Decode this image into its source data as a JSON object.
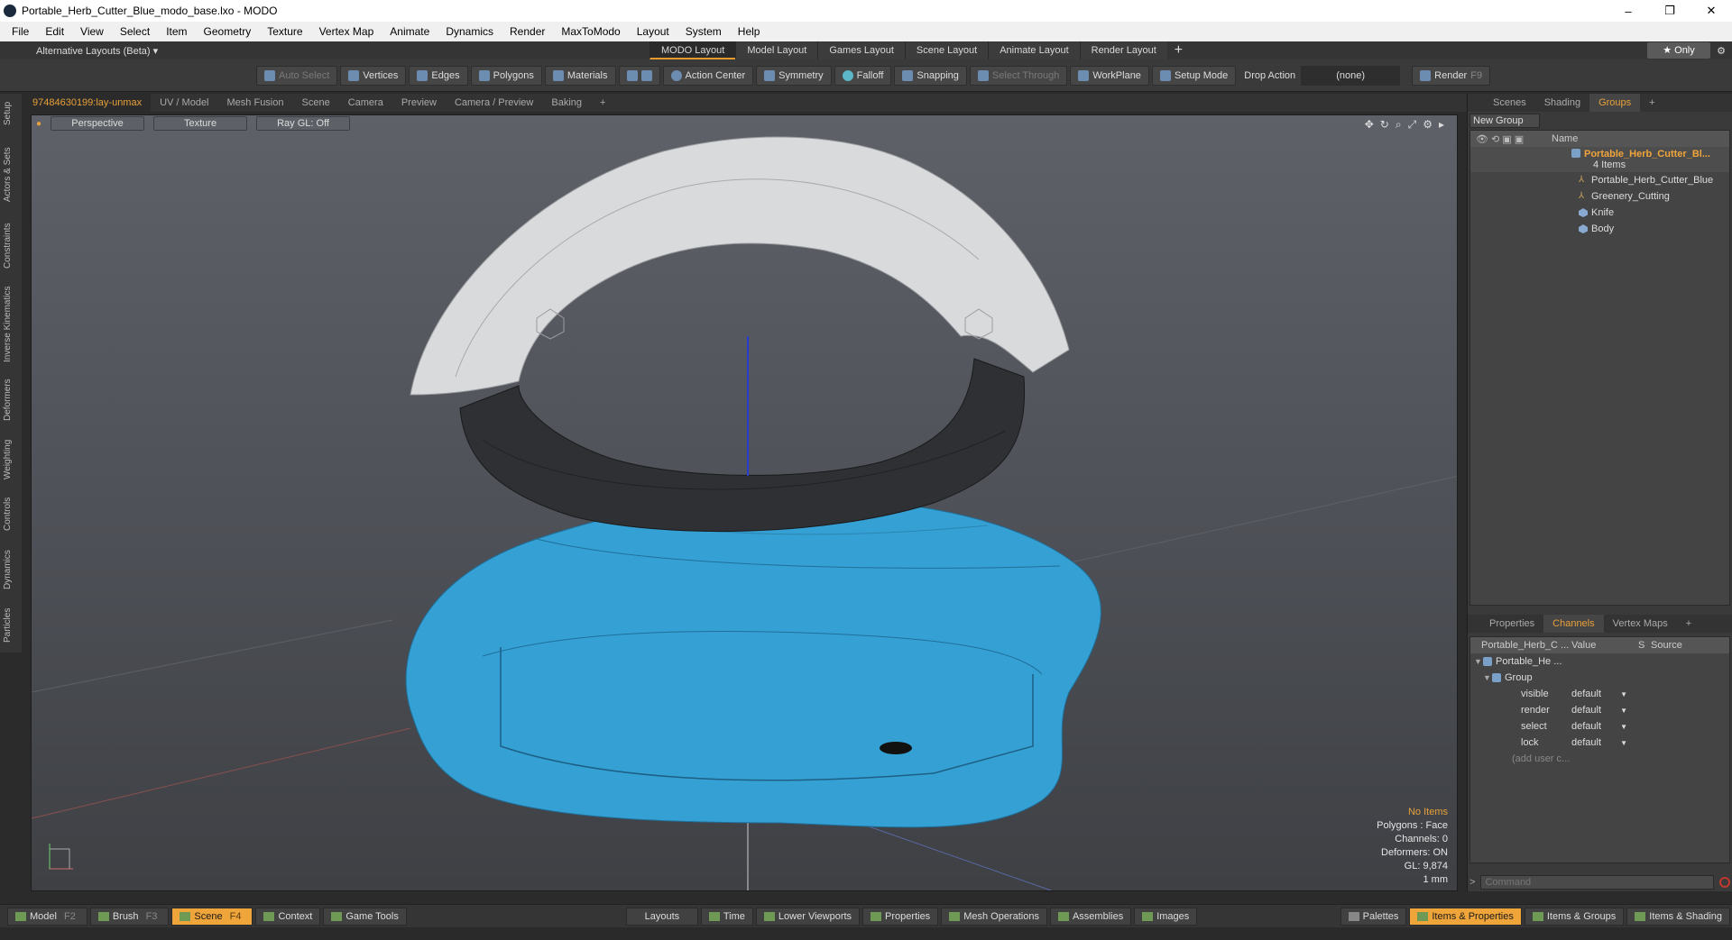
{
  "window": {
    "title": "Portable_Herb_Cutter_Blue_modo_base.lxo - MODO",
    "minimize": "–",
    "restore": "❐",
    "close": "✕"
  },
  "menu": [
    "File",
    "Edit",
    "View",
    "Select",
    "Item",
    "Geometry",
    "Texture",
    "Vertex Map",
    "Animate",
    "Dynamics",
    "Render",
    "MaxToModo",
    "Layout",
    "System",
    "Help"
  ],
  "layoutbar": {
    "alt_layouts": "Alternative Layouts (Beta) ▾",
    "tabs": [
      "MODO Layout",
      "Model Layout",
      "Games Layout",
      "Scene Layout",
      "Animate Layout",
      "Render Layout"
    ],
    "active_tab": "MODO Layout",
    "plus": "+",
    "only": "★ Only"
  },
  "toolbar": {
    "auto_select": "Auto Select",
    "vertices": "Vertices",
    "edges": "Edges",
    "polygons": "Polygons",
    "materials": "Materials",
    "action_center": "Action Center",
    "symmetry": "Symmetry",
    "falloff": "Falloff",
    "snapping": "Snapping",
    "select_through": "Select Through",
    "workplane": "WorkPlane",
    "setup_mode": "Setup Mode",
    "drop_action": "Drop Action",
    "drop_value": "(none)",
    "render": "Render",
    "render_key": "F9"
  },
  "left_tabs": [
    "Setup",
    "Actors & Sets",
    "Constraints",
    "Inverse Kinematics",
    "Deformers",
    "Weighting",
    "Controls",
    "Dynamics",
    "Particles"
  ],
  "viewport_tabs": [
    "97484630199:lay-unmax",
    "UV / Model",
    "Mesh Fusion",
    "Scene",
    "Camera",
    "Preview",
    "Camera / Preview",
    "Baking",
    "+"
  ],
  "viewport": {
    "view_mode": "Perspective",
    "shading": "Texture",
    "raygl": "Ray GL: Off",
    "info": {
      "no_items": "No Items",
      "polygons": "Polygons : Face",
      "channels": "Channels: 0",
      "deformers": "Deformers: ON",
      "gl": "GL: 9,874",
      "unit": "1 mm"
    },
    "colors": {
      "lid": "#d9dadc",
      "band": "#2f3033",
      "base": "#35a0d4"
    }
  },
  "groups_panel": {
    "tabs": [
      "Scenes",
      "Shading",
      "Groups",
      "+"
    ],
    "active_tab": "Groups",
    "new_group": "New Group",
    "name_header": "Name",
    "group_name": "Portable_Herb_Cutter_Bl...",
    "group_count": "4 Items",
    "items": [
      "Portable_Herb_Cutter_Blue",
      "Greenery_Cutting",
      "Knife",
      "Body"
    ]
  },
  "channels_panel": {
    "tabs": [
      "Properties",
      "Channels",
      "Vertex Maps",
      "+"
    ],
    "active_tab": "Channels",
    "headers": [
      "Portable_Herb_C ...",
      "Value",
      "S",
      "Source"
    ],
    "root": "Portable_He ...",
    "group": "Group",
    "rows": [
      {
        "name": "visible",
        "value": "default"
      },
      {
        "name": "render",
        "value": "default"
      },
      {
        "name": "select",
        "value": "default"
      },
      {
        "name": "lock",
        "value": "default"
      }
    ],
    "add_user": "(add user c...",
    "command_placeholder": "Command"
  },
  "bottombar": {
    "left": [
      {
        "label": "Model",
        "key": "F2"
      },
      {
        "label": "Brush",
        "key": "F3"
      },
      {
        "label": "Scene",
        "key": "F4"
      },
      {
        "label": "Context",
        "key": ""
      },
      {
        "label": "Game Tools",
        "key": ""
      }
    ],
    "active": "Scene",
    "center": [
      "Layouts",
      "Time",
      "Lower Viewports",
      "Properties",
      "Mesh Operations",
      "Assemblies",
      "Images"
    ],
    "right": [
      "Palettes",
      "Items & Properties",
      "Items & Groups",
      "Items & Shading"
    ],
    "right_active": "Items & Properties"
  }
}
